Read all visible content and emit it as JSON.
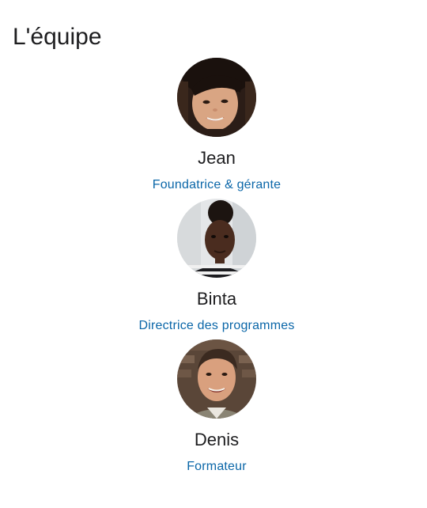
{
  "page": {
    "title": "L'équipe"
  },
  "team": [
    {
      "name": "Jean",
      "role": "Foundatrice & gérante",
      "avatar_icon": "avatar-photo-jean"
    },
    {
      "name": "Binta",
      "role": "Directrice des programmes",
      "avatar_icon": "avatar-photo-binta"
    },
    {
      "name": "Denis",
      "role": "Formateur",
      "avatar_icon": "avatar-photo-denis"
    }
  ],
  "colors": {
    "text": "#1d1d1f",
    "role_link": "#0a66a8",
    "background": "#ffffff"
  }
}
